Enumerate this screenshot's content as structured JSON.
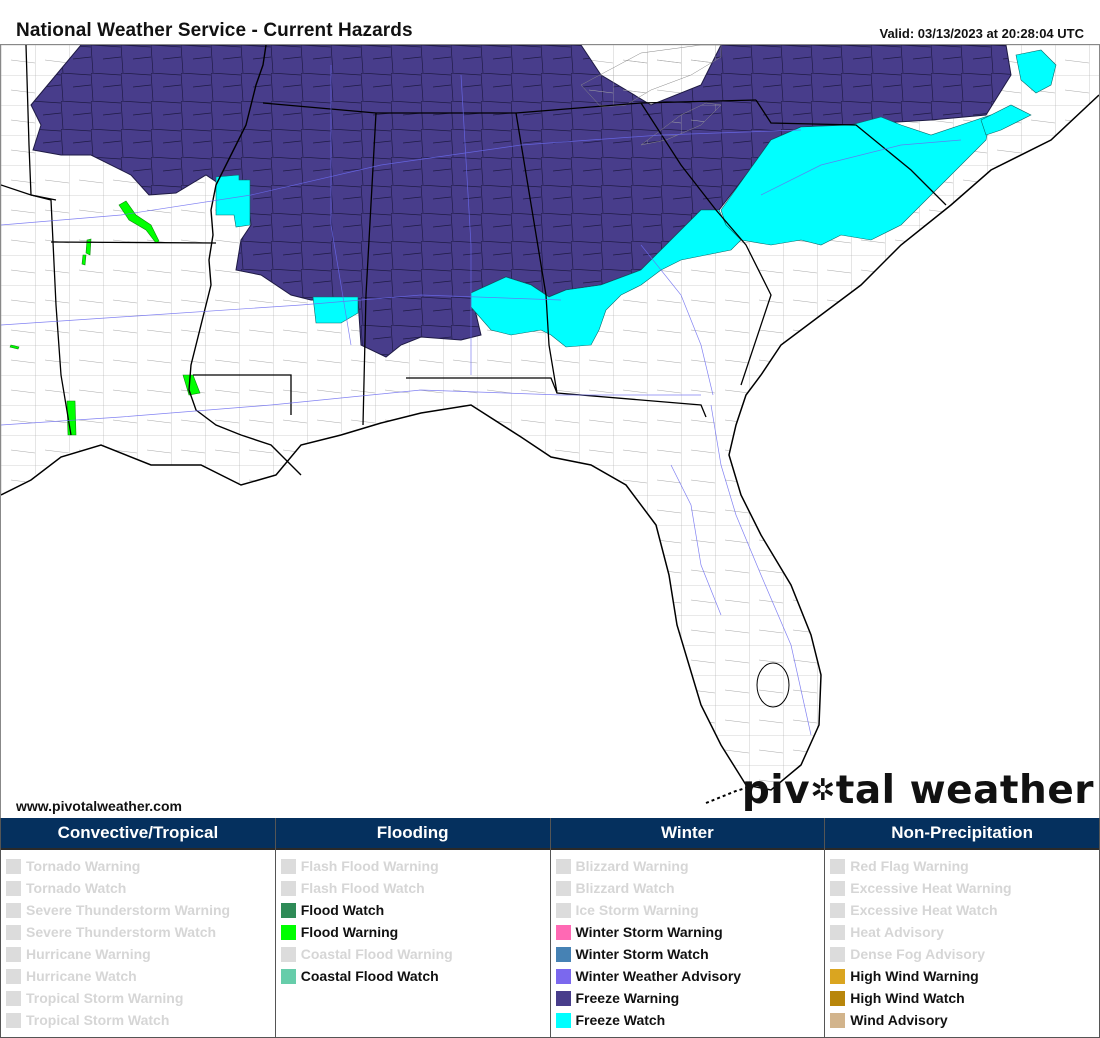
{
  "header": {
    "title": "National Weather Service - Current Hazards",
    "valid": "Valid: 03/13/2023 at 20:28:04 UTC"
  },
  "map": {
    "region": "Southeastern United States",
    "colors": {
      "land": "#ffffff",
      "county_lines": "#9a9a9a",
      "state_lines": "#000000",
      "rivers_roads": "#6b6bf0",
      "freeze_warning": "#483d8b",
      "freeze_watch": "#00ffff",
      "flood_warning": "#00ff00"
    },
    "active_hazards": [
      "Freeze Warning",
      "Freeze Watch",
      "Flood Warning"
    ]
  },
  "footer": {
    "url": "www.pivotalweather.com",
    "brand_left": "piv",
    "brand_right": "tal weather"
  },
  "legend": [
    {
      "title": "Convective/Tropical",
      "items": [
        {
          "label": "Tornado Warning",
          "active": false,
          "color": "#dcdcdc"
        },
        {
          "label": "Tornado Watch",
          "active": false,
          "color": "#dcdcdc"
        },
        {
          "label": "Severe Thunderstorm Warning",
          "active": false,
          "color": "#dcdcdc"
        },
        {
          "label": "Severe Thunderstorm Watch",
          "active": false,
          "color": "#dcdcdc"
        },
        {
          "label": "Hurricane Warning",
          "active": false,
          "color": "#dcdcdc"
        },
        {
          "label": "Hurricane Watch",
          "active": false,
          "color": "#dcdcdc"
        },
        {
          "label": "Tropical Storm Warning",
          "active": false,
          "color": "#dcdcdc"
        },
        {
          "label": "Tropical Storm Watch",
          "active": false,
          "color": "#dcdcdc"
        }
      ]
    },
    {
      "title": "Flooding",
      "items": [
        {
          "label": "Flash Flood Warning",
          "active": false,
          "color": "#dcdcdc"
        },
        {
          "label": "Flash Flood Watch",
          "active": false,
          "color": "#dcdcdc"
        },
        {
          "label": "Flood Watch",
          "active": true,
          "color": "#2e8b57"
        },
        {
          "label": "Flood Warning",
          "active": true,
          "color": "#00ff00"
        },
        {
          "label": "Coastal Flood Warning",
          "active": false,
          "color": "#dcdcdc"
        },
        {
          "label": "Coastal Flood Watch",
          "active": true,
          "color": "#66cdaa"
        }
      ]
    },
    {
      "title": "Winter",
      "items": [
        {
          "label": "Blizzard Warning",
          "active": false,
          "color": "#dcdcdc"
        },
        {
          "label": "Blizzard Watch",
          "active": false,
          "color": "#dcdcdc"
        },
        {
          "label": "Ice Storm Warning",
          "active": false,
          "color": "#dcdcdc"
        },
        {
          "label": "Winter Storm Warning",
          "active": true,
          "color": "#ff69b4"
        },
        {
          "label": "Winter Storm Watch",
          "active": true,
          "color": "#4682b4"
        },
        {
          "label": "Winter Weather Advisory",
          "active": true,
          "color": "#7b68ee"
        },
        {
          "label": "Freeze Warning",
          "active": true,
          "color": "#483d8b"
        },
        {
          "label": "Freeze Watch",
          "active": true,
          "color": "#00ffff"
        }
      ]
    },
    {
      "title": "Non-Precipitation",
      "items": [
        {
          "label": "Red Flag Warning",
          "active": false,
          "color": "#dcdcdc"
        },
        {
          "label": "Excessive Heat Warning",
          "active": false,
          "color": "#dcdcdc"
        },
        {
          "label": "Excessive Heat Watch",
          "active": false,
          "color": "#dcdcdc"
        },
        {
          "label": "Heat Advisory",
          "active": false,
          "color": "#dcdcdc"
        },
        {
          "label": "Dense Fog Advisory",
          "active": false,
          "color": "#dcdcdc"
        },
        {
          "label": "High Wind Warning",
          "active": true,
          "color": "#daa520"
        },
        {
          "label": "High Wind Watch",
          "active": true,
          "color": "#b8860b"
        },
        {
          "label": "Wind Advisory",
          "active": true,
          "color": "#d2b48c"
        }
      ]
    }
  ]
}
